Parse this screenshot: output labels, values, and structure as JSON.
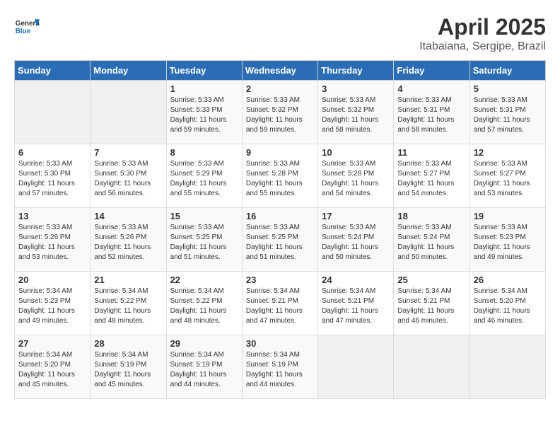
{
  "logo": {
    "general": "General",
    "blue": "Blue"
  },
  "title": "April 2025",
  "subtitle": "Itabaiana, Sergipe, Brazil",
  "days_of_week": [
    "Sunday",
    "Monday",
    "Tuesday",
    "Wednesday",
    "Thursday",
    "Friday",
    "Saturday"
  ],
  "weeks": [
    [
      {
        "day": "",
        "info": ""
      },
      {
        "day": "",
        "info": ""
      },
      {
        "day": "1",
        "info": "Sunrise: 5:33 AM\nSunset: 5:33 PM\nDaylight: 11 hours and 59 minutes."
      },
      {
        "day": "2",
        "info": "Sunrise: 5:33 AM\nSunset: 5:32 PM\nDaylight: 11 hours and 59 minutes."
      },
      {
        "day": "3",
        "info": "Sunrise: 5:33 AM\nSunset: 5:32 PM\nDaylight: 11 hours and 58 minutes."
      },
      {
        "day": "4",
        "info": "Sunrise: 5:33 AM\nSunset: 5:31 PM\nDaylight: 11 hours and 58 minutes."
      },
      {
        "day": "5",
        "info": "Sunrise: 5:33 AM\nSunset: 5:31 PM\nDaylight: 11 hours and 57 minutes."
      }
    ],
    [
      {
        "day": "6",
        "info": "Sunrise: 5:33 AM\nSunset: 5:30 PM\nDaylight: 11 hours and 57 minutes."
      },
      {
        "day": "7",
        "info": "Sunrise: 5:33 AM\nSunset: 5:30 PM\nDaylight: 11 hours and 56 minutes."
      },
      {
        "day": "8",
        "info": "Sunrise: 5:33 AM\nSunset: 5:29 PM\nDaylight: 11 hours and 55 minutes."
      },
      {
        "day": "9",
        "info": "Sunrise: 5:33 AM\nSunset: 5:28 PM\nDaylight: 11 hours and 55 minutes."
      },
      {
        "day": "10",
        "info": "Sunrise: 5:33 AM\nSunset: 5:28 PM\nDaylight: 11 hours and 54 minutes."
      },
      {
        "day": "11",
        "info": "Sunrise: 5:33 AM\nSunset: 5:27 PM\nDaylight: 11 hours and 54 minutes."
      },
      {
        "day": "12",
        "info": "Sunrise: 5:33 AM\nSunset: 5:27 PM\nDaylight: 11 hours and 53 minutes."
      }
    ],
    [
      {
        "day": "13",
        "info": "Sunrise: 5:33 AM\nSunset: 5:26 PM\nDaylight: 11 hours and 53 minutes."
      },
      {
        "day": "14",
        "info": "Sunrise: 5:33 AM\nSunset: 5:26 PM\nDaylight: 11 hours and 52 minutes."
      },
      {
        "day": "15",
        "info": "Sunrise: 5:33 AM\nSunset: 5:25 PM\nDaylight: 11 hours and 51 minutes."
      },
      {
        "day": "16",
        "info": "Sunrise: 5:33 AM\nSunset: 5:25 PM\nDaylight: 11 hours and 51 minutes."
      },
      {
        "day": "17",
        "info": "Sunrise: 5:33 AM\nSunset: 5:24 PM\nDaylight: 11 hours and 50 minutes."
      },
      {
        "day": "18",
        "info": "Sunrise: 5:33 AM\nSunset: 5:24 PM\nDaylight: 11 hours and 50 minutes."
      },
      {
        "day": "19",
        "info": "Sunrise: 5:33 AM\nSunset: 5:23 PM\nDaylight: 11 hours and 49 minutes."
      }
    ],
    [
      {
        "day": "20",
        "info": "Sunrise: 5:34 AM\nSunset: 5:23 PM\nDaylight: 11 hours and 49 minutes."
      },
      {
        "day": "21",
        "info": "Sunrise: 5:34 AM\nSunset: 5:22 PM\nDaylight: 11 hours and 48 minutes."
      },
      {
        "day": "22",
        "info": "Sunrise: 5:34 AM\nSunset: 5:22 PM\nDaylight: 11 hours and 48 minutes."
      },
      {
        "day": "23",
        "info": "Sunrise: 5:34 AM\nSunset: 5:21 PM\nDaylight: 11 hours and 47 minutes."
      },
      {
        "day": "24",
        "info": "Sunrise: 5:34 AM\nSunset: 5:21 PM\nDaylight: 11 hours and 47 minutes."
      },
      {
        "day": "25",
        "info": "Sunrise: 5:34 AM\nSunset: 5:21 PM\nDaylight: 11 hours and 46 minutes."
      },
      {
        "day": "26",
        "info": "Sunrise: 5:34 AM\nSunset: 5:20 PM\nDaylight: 11 hours and 46 minutes."
      }
    ],
    [
      {
        "day": "27",
        "info": "Sunrise: 5:34 AM\nSunset: 5:20 PM\nDaylight: 11 hours and 45 minutes."
      },
      {
        "day": "28",
        "info": "Sunrise: 5:34 AM\nSunset: 5:19 PM\nDaylight: 11 hours and 45 minutes."
      },
      {
        "day": "29",
        "info": "Sunrise: 5:34 AM\nSunset: 5:19 PM\nDaylight: 11 hours and 44 minutes."
      },
      {
        "day": "30",
        "info": "Sunrise: 5:34 AM\nSunset: 5:19 PM\nDaylight: 11 hours and 44 minutes."
      },
      {
        "day": "",
        "info": ""
      },
      {
        "day": "",
        "info": ""
      },
      {
        "day": "",
        "info": ""
      }
    ]
  ]
}
